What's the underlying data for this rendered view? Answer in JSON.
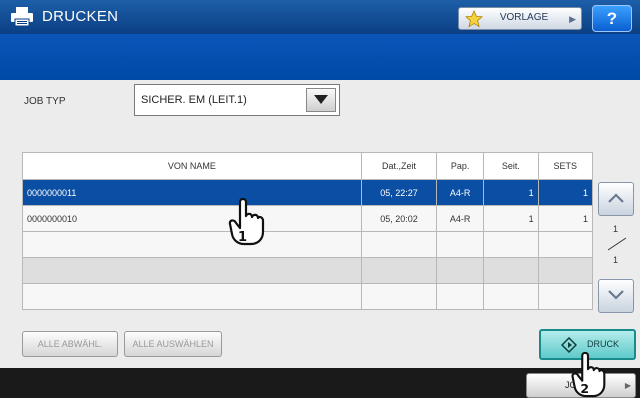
{
  "header": {
    "title": "DRUCKEN",
    "template_button": "VORLAGE",
    "help_button": "?"
  },
  "job_type": {
    "label": "JOB TYP",
    "selected": "SICHER. EM (LEIT.1)"
  },
  "table": {
    "columns": [
      "VON NAME",
      "Dat.,Zeit",
      "Pap.",
      "Seit.",
      "SETS"
    ],
    "rows": [
      {
        "name": "0000000011",
        "date": "05, 22:27",
        "paper": "A4-R",
        "pages": "1",
        "sets": "1",
        "selected": true
      },
      {
        "name": "0000000010",
        "date": "05, 20:02",
        "paper": "A4-R",
        "pages": "1",
        "sets": "1",
        "selected": false
      }
    ],
    "empty_rows": 3
  },
  "pagination": {
    "current": "1",
    "total": "1"
  },
  "buttons": {
    "clear_all": "ALLE ABWÄHL.",
    "select_all": "ALLE AUSWÄHLEN",
    "print": "DRUCK",
    "jobs": "JOB"
  },
  "step_markers": [
    "1",
    "2"
  ],
  "colors": {
    "header": "#0b3f84",
    "band": "#004aa6",
    "selected_row": "#0a4fa3",
    "print_button": "#5fcaca"
  }
}
